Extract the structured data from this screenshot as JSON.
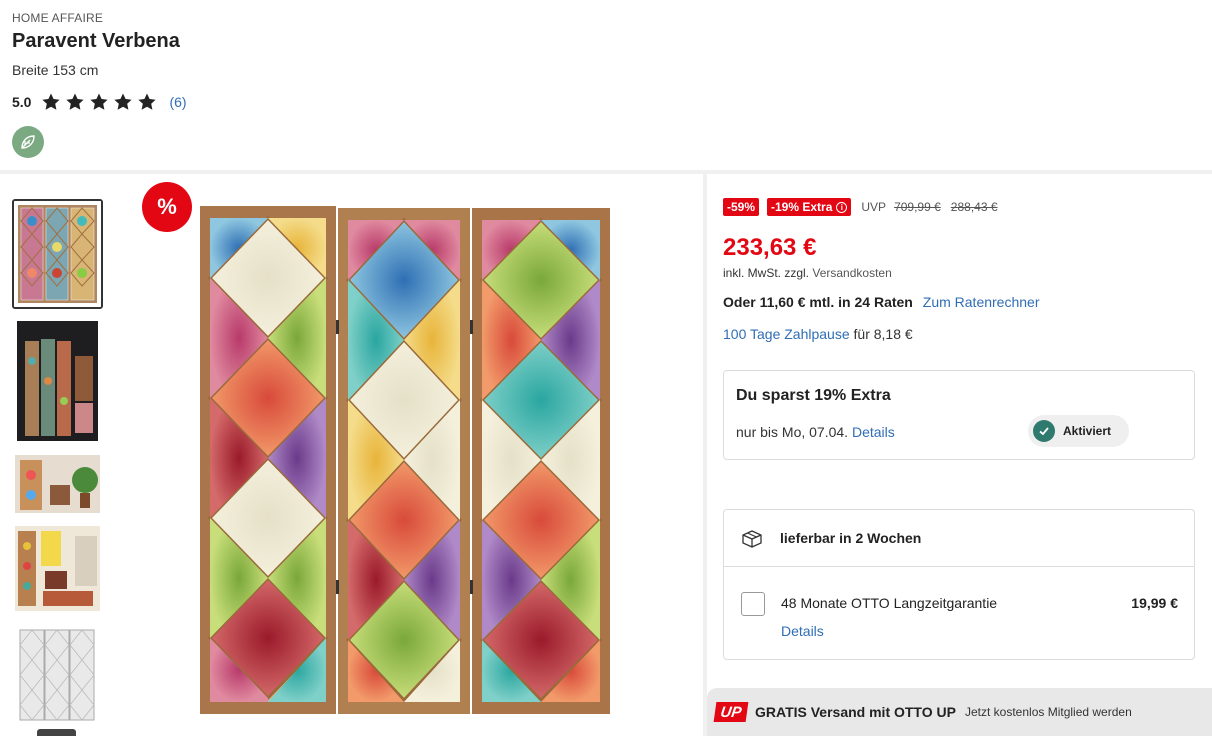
{
  "product": {
    "brand": "HOME AFFAIRE",
    "title": "Paravent Verbena",
    "variant": "Breite 153 cm",
    "rating_value": "5.0",
    "rating_stars": 5,
    "rating_count": "(6)"
  },
  "gallery": {
    "sale_badge": "%",
    "thumbnails": [
      "thumbnail-1",
      "thumbnail-2",
      "thumbnail-3",
      "thumbnail-4",
      "thumbnail-5"
    ],
    "selected_index": 0
  },
  "pricing": {
    "discount_badge": "-59%",
    "extra_badge": "-19% Extra",
    "uvp_label": "UVP",
    "uvp_price": "709,99 €",
    "old_price": "288,43 €",
    "price": "233,63 €",
    "tax_note": "inkl. MwSt. zzgl.",
    "shipping_link": "Versandkosten",
    "installment_text": "Oder 11,60 € mtl. in 24 Raten",
    "installment_link": "Zum Ratenrechner",
    "pause_link": "100 Tage Zahlpause",
    "pause_text": "für 8,18 €"
  },
  "savings_card": {
    "title": "Du sparst 19% Extra",
    "until_text": "nur bis Mo, 07.04.",
    "details_link": "Details",
    "activated_label": "Aktiviert"
  },
  "delivery_card": {
    "delivery_text": "lieferbar in 2 Wochen",
    "warranty_text": "48 Monate OTTO Langzeitgarantie",
    "warranty_price": "19,99 €",
    "warranty_details": "Details"
  },
  "otto_up": {
    "logo": "UP",
    "title": "GRATIS Versand mit OTTO UP",
    "subtitle": "Jetzt kostenlos Mitglied werden"
  },
  "colors": {
    "accent_red": "#e30613",
    "link_blue": "#2f6eb5",
    "eco_green": "#7aa982",
    "check_green": "#2f7a6e"
  }
}
